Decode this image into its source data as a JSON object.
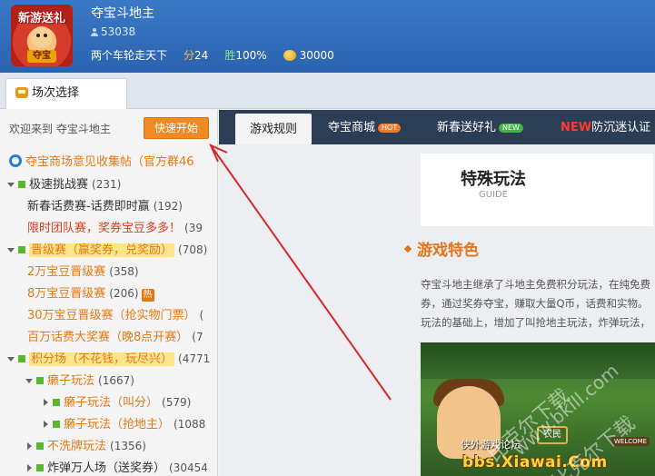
{
  "profile": {
    "avatar_badge_top": "新游送礼",
    "avatar_badge_bottom": "夺宝",
    "name": "夺宝斗地主",
    "id": "53038",
    "motto": "两个车轮走天下",
    "score_label": "分",
    "score": "24",
    "win_label": "胜",
    "win_rate": "100%",
    "coins": "30000"
  },
  "tabs": {
    "current": "场次选择"
  },
  "left_panel": {
    "welcome": "欢迎来到 夺宝斗地主",
    "quick_start": "快速开始",
    "tree": [
      {
        "label": "夺宝商场意见收集帖（官方群46",
        "count": ""
      },
      {
        "label": "极速挑战赛",
        "count": "(231)"
      },
      {
        "label": "新春话费赛-话费即时赢",
        "count": "(192)"
      },
      {
        "label": "限时团队赛，奖券宝豆多多！",
        "count": "(39"
      },
      {
        "label": "晋级赛（赢奖券，兑奖励）",
        "count": "(708)"
      },
      {
        "label": "2万宝豆晋级赛",
        "count": "(358)"
      },
      {
        "label": "8万宝豆晋级赛",
        "count": "(206)",
        "tag": "热"
      },
      {
        "label": "30万宝豆晋级赛（抢实物门票）",
        "count": "("
      },
      {
        "label": "百万话费大奖赛（晚8点开赛）",
        "count": "(7"
      },
      {
        "label": "积分场（不花钱，玩尽兴）",
        "count": "(4771"
      },
      {
        "label": "癞子玩法",
        "count": "(1667)"
      },
      {
        "label": "癞子玩法（叫分）",
        "count": "(579)"
      },
      {
        "label": "癞子玩法（抢地主）",
        "count": "(1088"
      },
      {
        "label": "不洗牌玩法",
        "count": "(1356)"
      },
      {
        "label": "炸弹万人场（送奖券）",
        "count": "(30454"
      }
    ]
  },
  "main": {
    "nav": [
      {
        "label": "游戏规则"
      },
      {
        "label": "夺宝商城",
        "badge": "HOT"
      },
      {
        "label": "新春送好礼",
        "badge": "NEW"
      },
      {
        "label_prefix": "NEW",
        "label": "防沉迷认证"
      }
    ],
    "card_title": "特殊玩法",
    "card_sub": "GUIDE",
    "section_title": "游戏特色",
    "paragraph": [
      "夺宝斗地主继承了斗地主免费积分玩法，在纯免费",
      "券，通过奖券夺宝，赚取大量Q币，话费和实物。",
      "玩法的基础上，增加了叫抢地主玩法，炸弹玩法，"
    ],
    "image_labels": {
      "farmer": "农民",
      "forum": "侠外游戏论坛",
      "site": "bbs.Xiawai.Com",
      "welcome": "WELCOME"
    }
  },
  "watermark": {
    "line1": "比克尔下载",
    "line2": "www.bkill.com",
    "line3": "比克尔下载"
  },
  "colors": {
    "header_blue": "#2b63b0",
    "accent_orange": "#f08a24",
    "nav_dark": "#2c3e56",
    "arrow_red": "#d42a2a"
  }
}
